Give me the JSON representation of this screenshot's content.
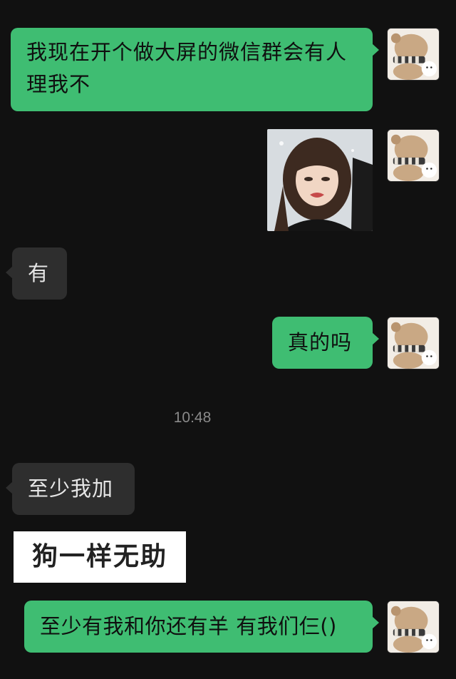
{
  "chat": {
    "messages": [
      {
        "side": "right",
        "type": "text",
        "line1": "我现在开个做大屏的微信群会有人",
        "line2": "理我不"
      },
      {
        "side": "right",
        "type": "image",
        "image_name": "crying-girl-photo"
      },
      {
        "side": "left",
        "type": "text",
        "text": "有"
      },
      {
        "side": "right",
        "type": "text",
        "text": "真的吗"
      },
      {
        "side": "left",
        "type": "text",
        "text": "至少我加"
      },
      {
        "side": "left",
        "type": "sticker-text",
        "text": "狗一样无助"
      },
      {
        "side": "right",
        "type": "text",
        "text": "至少有我和你还有羊 有我们仨()"
      }
    ],
    "timestamp": "10:48",
    "colors": {
      "background": "#111111",
      "self_bubble": "#3fbd72",
      "other_bubble": "#2e2e2e",
      "timestamp_text": "#8a8a8a"
    },
    "avatar_icon": "plush-bear-avatar"
  }
}
